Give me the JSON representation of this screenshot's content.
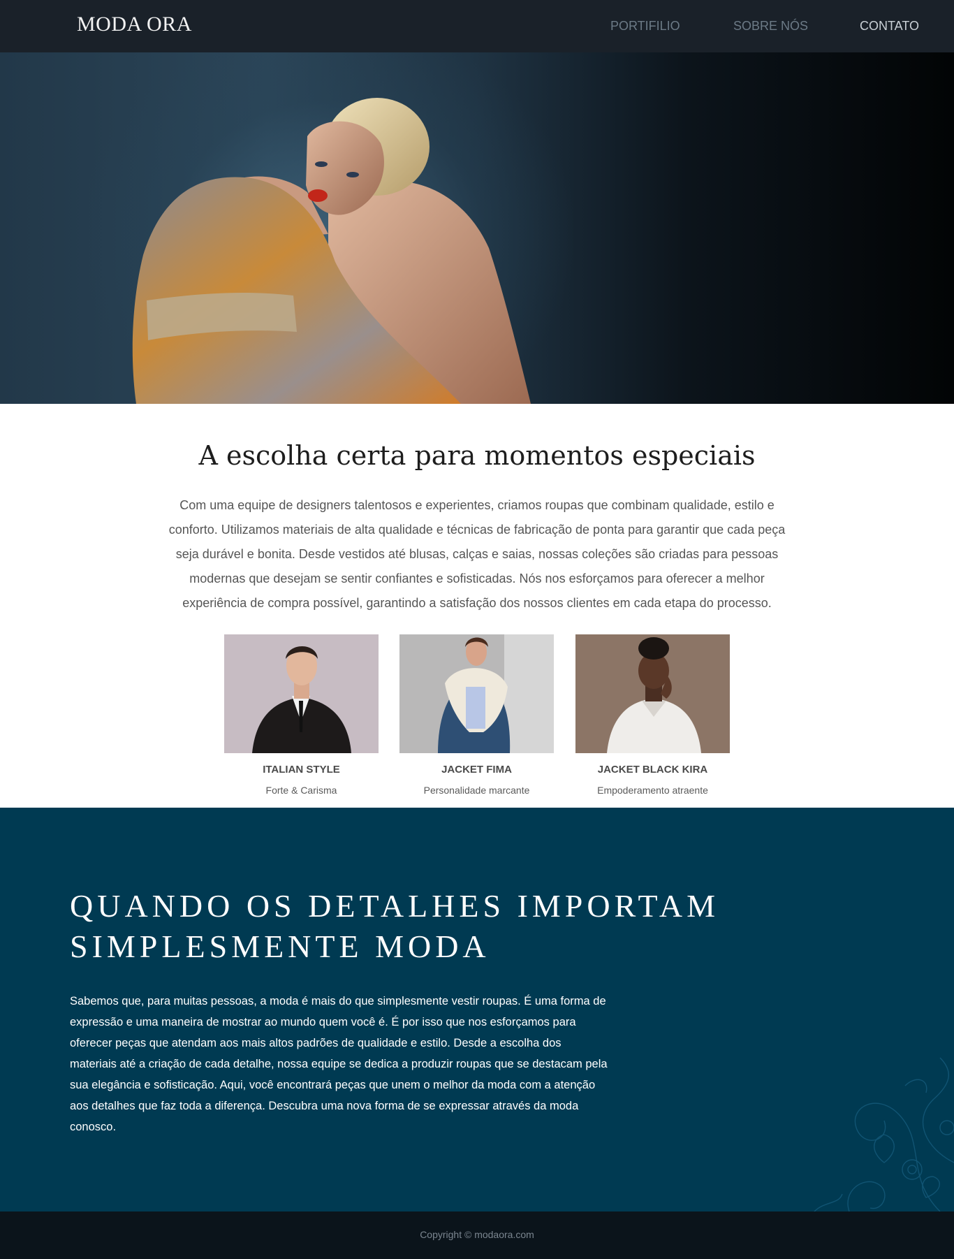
{
  "nav": {
    "logo": "MODA ORA",
    "links": [
      {
        "label": "PORTIFILIO"
      },
      {
        "label": "SOBRE NÓS"
      },
      {
        "label": "CONTATO"
      }
    ]
  },
  "intro": {
    "title": "A escolha certa para momentos especiais",
    "text": "Com uma equipe de designers talentosos e experientes, criamos roupas que combinam qualidade, estilo e conforto. Utilizamos materiais de alta qualidade e técnicas de fabricação de ponta para garantir que cada peça seja durável e bonita. Desde vestidos até blusas, calças e saias, nossas coleções são criadas para pessoas modernas que desejam se sentir confiantes e sofisticadas. Nós nos esforçamos para oferecer a melhor experiência de compra possível, garantindo a satisfação dos nossos clientes em cada etapa do processo."
  },
  "cards": [
    {
      "title": "ITALIAN STYLE",
      "subtitle": "Forte & Carisma"
    },
    {
      "title": "JACKET FIMA",
      "subtitle": "Personalidade marcante"
    },
    {
      "title": "JACKET BLACK KIRA",
      "subtitle": "Empoderamento atraente"
    }
  ],
  "details": {
    "title_line1": "QUANDO OS DETALHES IMPORTAM",
    "title_line2": "SIMPLESMENTE MODA",
    "text": "Sabemos que, para muitas pessoas, a moda é mais do que simplesmente vestir roupas. É uma forma de expressão e uma maneira de mostrar ao mundo quem você é. É por isso que nos esforçamos para oferecer peças que atendam aos mais altos padrões de qualidade e estilo. Desde a escolha dos materiais até a criação de cada detalhe, nossa equipe se dedica a produzir roupas que se destacam pela sua elegância e sofisticação. Aqui, você encontrará peças que unem o melhor da moda com a atenção aos detalhes que faz toda a diferença. Descubra uma nova forma de se expressar através da moda conosco."
  },
  "footer": {
    "copyright": "Copyright © modaora.com"
  },
  "colors": {
    "nav_bg": "#1a2129",
    "details_bg": "#003a52",
    "footer_bg": "#0b141b"
  }
}
